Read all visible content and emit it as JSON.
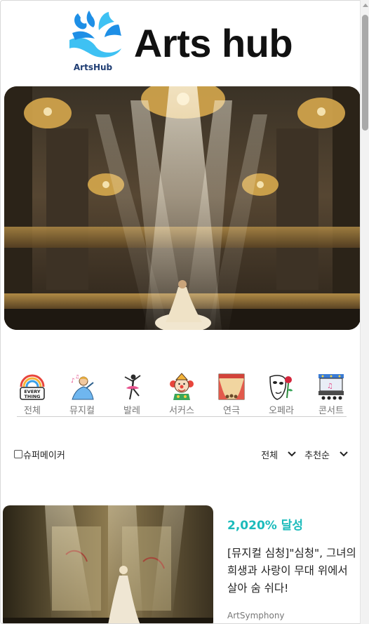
{
  "header": {
    "logo_caption": "ArtsHub",
    "title": "Arts hub",
    "logo_icon": "splash-logo-icon",
    "colors": {
      "logo_light": "#3ec1f3",
      "logo_dark": "#1e8fe6"
    }
  },
  "hero": {
    "image": "opera-house-stage-with-dancer"
  },
  "categories": [
    {
      "label": "전체",
      "icon": "everything-rainbow-icon"
    },
    {
      "label": "뮤지컬",
      "icon": "musical-singer-icon"
    },
    {
      "label": "발레",
      "icon": "ballerina-icon"
    },
    {
      "label": "서커스",
      "icon": "clown-icon"
    },
    {
      "label": "연극",
      "icon": "theater-curtain-icon"
    },
    {
      "label": "오페라",
      "icon": "opera-mask-rose-icon"
    },
    {
      "label": "콘서트",
      "icon": "concert-stage-icon"
    }
  ],
  "filters": {
    "supermaker_label": "슈퍼메이커",
    "type_select": "전체",
    "sort_select": "추천순"
  },
  "card": {
    "achievement": "2,020% 달성",
    "description": "[뮤지컬 심청]\"심청\", 그녀의 희생과 사랑이 무대 위에서 살아 숨 쉬다!",
    "owner": "ArtSymphony",
    "image": "korean-performer-on-stage",
    "accent_color": "#1bbbbb"
  }
}
